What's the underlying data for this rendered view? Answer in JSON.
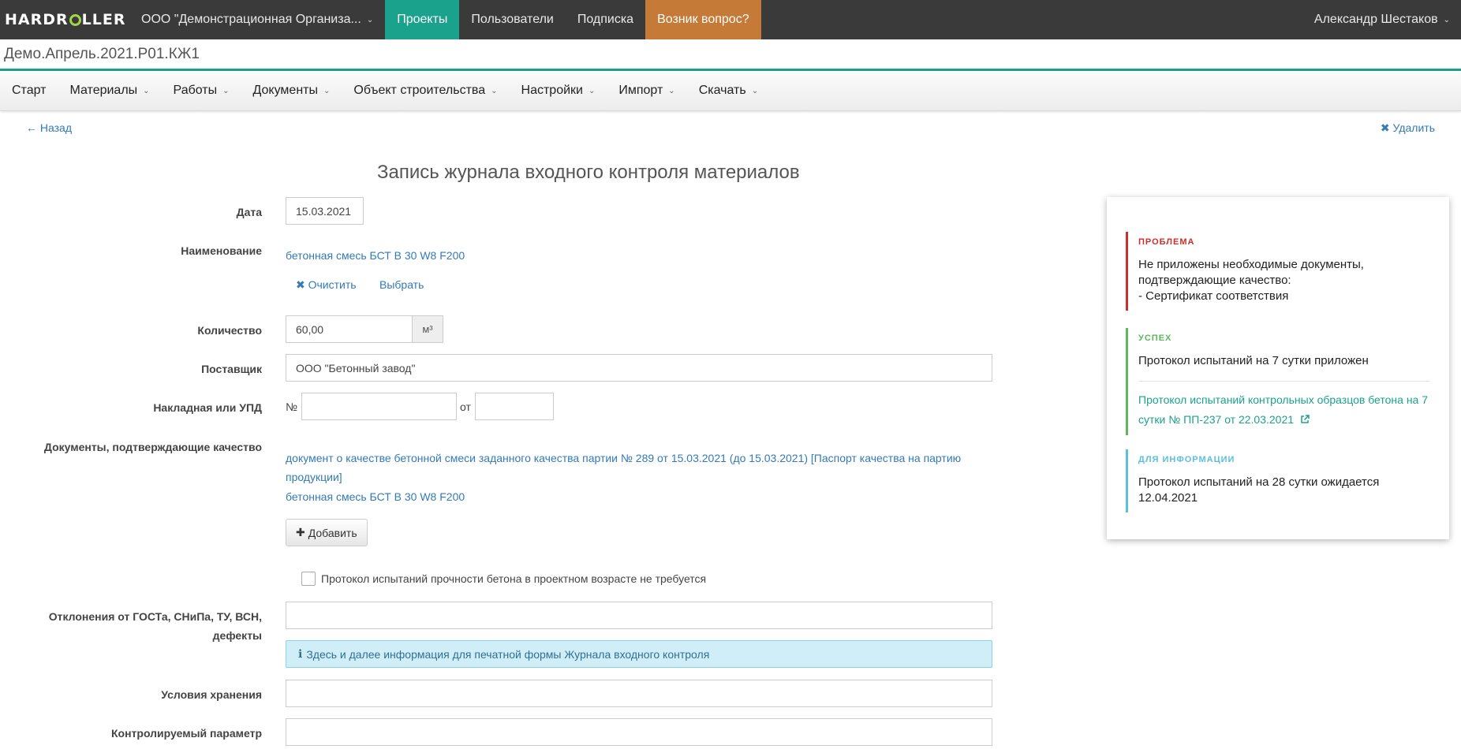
{
  "topbar": {
    "logo_left": "HARDR",
    "logo_right": "LLER",
    "org": "ООО \"Демонстрационная Организа...",
    "nav": [
      "Проекты",
      "Пользователи",
      "Подписка"
    ],
    "help": "Возник вопрос?",
    "user": "Александр Шестаков",
    "colors": {
      "dark": "#3a3a3a",
      "accent": "#1ba28c",
      "help": "#c57a37"
    }
  },
  "project": {
    "name": "Демо.Апрель.2021.Р01.КЖ1"
  },
  "menu": [
    "Старт",
    "Материалы",
    "Работы",
    "Документы",
    "Объект строительства",
    "Настройки",
    "Импорт",
    "Скачать"
  ],
  "actions": {
    "back": "← Назад",
    "delete": "Удалить"
  },
  "title": "Запись журнала входного контроля материалов",
  "form": {
    "date": {
      "label": "Дата",
      "value": "15.03.2021"
    },
    "name": {
      "label": "Наименование",
      "value": "бетонная смесь БСТ В 30 W8 F200",
      "clear": "Очистить",
      "choose": "Выбрать"
    },
    "quantity": {
      "label": "Количество",
      "value": "60,00",
      "unit": "м³"
    },
    "supplier": {
      "label": "Поставщик",
      "value": "ООО \"Бетонный завод\""
    },
    "invoice": {
      "label": "Накладная или УПД",
      "num_prefix": "№",
      "from_prefix": "от",
      "number": "",
      "date": ""
    },
    "documents": {
      "label": "Документы, подтверждающие качество",
      "doc_line1": "документ о качестве бетонной смеси заданного качества партии № 289  от 15.03.2021  (до 15.03.2021) [Паспорт качества на партию",
      "doc_line2": "продукции]",
      "doc_material": "бетонная смесь БСТ В 30 W8 F200",
      "add": "Добавить"
    },
    "protocol_checkbox": "Протокол испытаний прочности бетона в проектном возрасте не требуется",
    "deviations": {
      "label_line1": "Отклонения от ГОСТа, СНиПа, ТУ, ВСН,",
      "label_line2": "дефекты",
      "value": ""
    },
    "info_note": "Здесь и далее информация для печатной формы Журнала входного контроля",
    "storage": {
      "label": "Условия хранения",
      "value": ""
    },
    "param": {
      "label": "Контролируемый параметр",
      "value": ""
    }
  },
  "panel": {
    "problem": {
      "title": "ПРОБЛЕМА",
      "text": "Не приложены необходимые документы,\nподтверждающие качество:\n - Сертификат соответствия"
    },
    "success": {
      "title": "УСПЕХ",
      "text": "Протокол испытаний на 7 сутки приложен",
      "link_line1": "Протокол испытаний контрольных образцов бетона на 7",
      "link_line2": "сутки № ПП-237 от 22.03.2021"
    },
    "info": {
      "title": "ДЛЯ ИНФОРМАЦИИ",
      "text": "Протокол испытаний на 28 сутки ожидается\n12.04.2021"
    }
  }
}
